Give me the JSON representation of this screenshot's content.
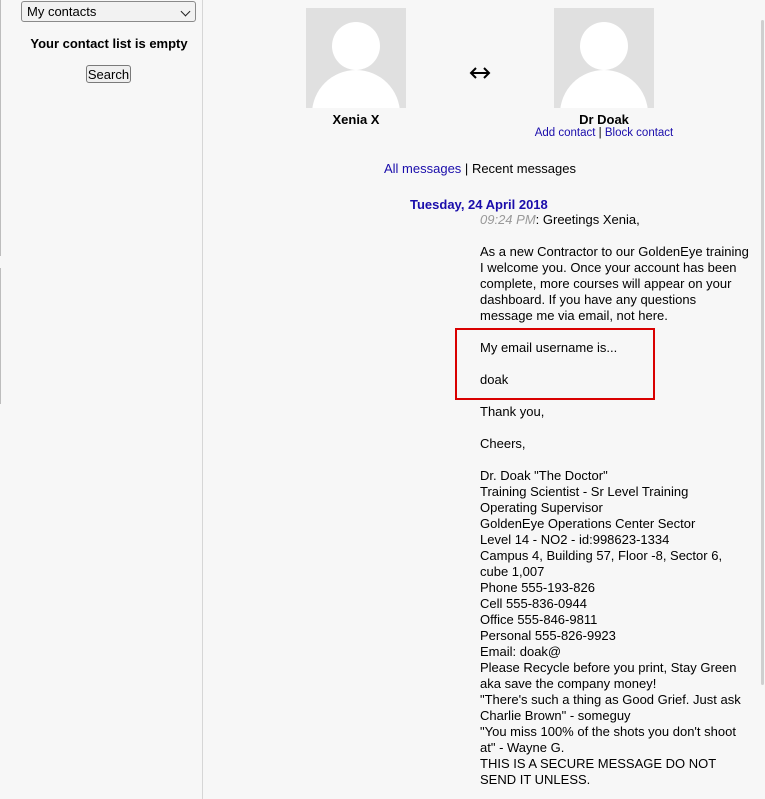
{
  "sidebar": {
    "contact_filter": "My contacts",
    "empty_message": "Your contact list is empty",
    "search_label": "Search"
  },
  "conversation": {
    "me_name": "Xenia X",
    "other_name": "Dr Doak",
    "add_contact": "Add contact",
    "separator": "|",
    "block_contact": "Block contact",
    "all_messages": "All messages",
    "recent_messages": "Recent messages",
    "date": "Tuesday, 24 April 2018",
    "time": "09:24 PM",
    "greeting": ": Greetings Xenia,",
    "paragraph1_lines": [
      "As a new Contractor to our GoldenEye training",
      "I welcome you. Once your account has been",
      "complete, more courses will appear on your",
      "dashboard. If you have any questions",
      "message me via email, not here."
    ],
    "username_line": "My email username is...",
    "username": "doak",
    "thanks": "Thank you,",
    "cheers": "Cheers,",
    "signature_lines": [
      "Dr. Doak \"The Doctor\"",
      "Training Scientist - Sr Level Training",
      "Operating Supervisor",
      "GoldenEye Operations Center Sector",
      "Level 14 - NO2 - id:998623-1334",
      "Campus 4, Building 57, Floor -8, Sector 6,",
      "cube 1,007",
      "Phone 555-193-826",
      "Cell 555-836-0944",
      "Office 555-846-9811",
      "Personal 555-826-9923",
      "Email: doak@",
      "Please Recycle before you print, Stay Green",
      "aka save the company money!",
      "\"There's such a thing as Good Grief. Just ask",
      "Charlie Brown\" - someguy",
      "\"You miss 100% of the shots you don't shoot",
      "at\" - Wayne G.",
      "THIS IS A SECURE MESSAGE DO NOT",
      "SEND IT UNLESS."
    ]
  },
  "colors": {
    "link": "#1a0dab",
    "highlight": "#d90000"
  }
}
